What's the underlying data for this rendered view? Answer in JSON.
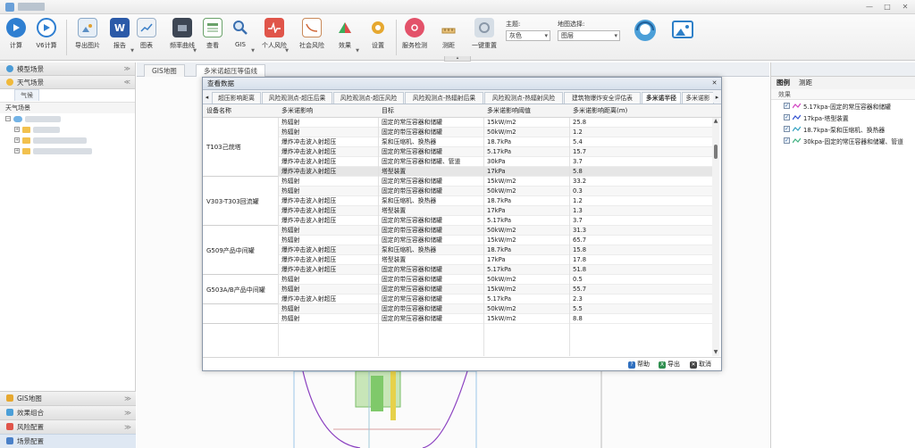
{
  "toolbar": {
    "items": [
      {
        "label": "计算",
        "icon": "play-icon"
      },
      {
        "label": "V6计算",
        "icon": "play-circle-icon"
      },
      {
        "label": "导出图片",
        "icon": "image-icon"
      },
      {
        "label": "报告",
        "icon": "word-icon"
      },
      {
        "label": "图表",
        "icon": "chart-icon"
      },
      {
        "label": "频率曲线",
        "icon": "film-icon"
      },
      {
        "label": "查看",
        "icon": "table-icon"
      },
      {
        "label": "GIS",
        "icon": "search-icon"
      },
      {
        "label": "个人风险",
        "icon": "pulse-icon"
      },
      {
        "label": "社会风险",
        "icon": "curve-icon"
      },
      {
        "label": "效果",
        "icon": "pyramid-icon"
      },
      {
        "label": "设置",
        "icon": "gear-icon"
      },
      {
        "label": "服务检测",
        "icon": "service-icon"
      },
      {
        "label": "测距",
        "icon": "ruler-icon"
      },
      {
        "label": "一键重置",
        "icon": "reset-icon"
      }
    ],
    "theme": {
      "caption": "主题:",
      "value": "灰色"
    },
    "map_select": {
      "caption": "地图选择:",
      "value": "图层"
    }
  },
  "left": {
    "model_scene": "模型场景",
    "weather_scene": "天气场景",
    "subtab": "气候",
    "tree_title": "天气场景",
    "gis_map": "GIS地图",
    "effect_group": "效果组合",
    "risk_config": "风险配置",
    "scene_config": "场景配置"
  },
  "center": {
    "tabs": [
      "GIS地图",
      "多米诺超压等值线"
    ]
  },
  "right": {
    "tabs": [
      "图例",
      "测距"
    ],
    "sub": "效果",
    "legend": [
      {
        "label": "5.17kpa-固定的常压容器和储罐",
        "color": "#d040c0"
      },
      {
        "label": "17kpa-塔型装置",
        "color": "#3050d0"
      },
      {
        "label": "18.7kpa-泵和压缩机、换热器",
        "color": "#30a0c0"
      },
      {
        "label": "30kpa-固定的常压容器和储罐、管道",
        "color": "#40b080"
      }
    ]
  },
  "modal": {
    "title": "查看数据",
    "tabs": [
      "超压影响距离",
      "风险观测点-超压后果",
      "风险观测点-超压风险",
      "风险观测点-热辐射后果",
      "风险观测点-热辐射风险",
      "建筑物爆炸安全评估表",
      "多米诺半径",
      "多米诺影"
    ],
    "columns": [
      "设备名称",
      "多米诺影响",
      "目标",
      "多米诺影响阈值",
      "多米诺影响距离(m)"
    ],
    "groups": [
      {
        "device": "T103己烷塔",
        "rows": [
          [
            "热辐射",
            "固定的常压容器和储罐",
            "15kW/m2",
            "25.8"
          ],
          [
            "热辐射",
            "固定的带压容器和储罐",
            "50kW/m2",
            "1.2"
          ],
          [
            "爆炸冲击波入射超压",
            "泵和压缩机、换热器",
            "18.7kPa",
            "5.4"
          ],
          [
            "爆炸冲击波入射超压",
            "固定的常压容器和储罐",
            "5.17kPa",
            "15.7"
          ],
          [
            "爆炸冲击波入射超压",
            "固定的常压容器和储罐、管道",
            "30kPa",
            "3.7"
          ],
          [
            "爆炸冲击波入射超压",
            "塔型装置",
            "17kPa",
            "5.8"
          ]
        ]
      },
      {
        "device": "V303-T303回流罐",
        "rows": [
          [
            "热辐射",
            "固定的常压容器和储罐",
            "15kW/m2",
            "33.2"
          ],
          [
            "热辐射",
            "固定的带压容器和储罐",
            "50kW/m2",
            "0.3"
          ],
          [
            "爆炸冲击波入射超压",
            "泵和压缩机、换热器",
            "18.7kPa",
            "1.2"
          ],
          [
            "爆炸冲击波入射超压",
            "塔型装置",
            "17kPa",
            "1.3"
          ],
          [
            "爆炸冲击波入射超压",
            "固定的常压容器和储罐",
            "5.17kPa",
            "3.7"
          ]
        ]
      },
      {
        "device": "G509产品中间罐",
        "rows": [
          [
            "热辐射",
            "固定的带压容器和储罐",
            "50kW/m2",
            "31.3"
          ],
          [
            "热辐射",
            "固定的常压容器和储罐",
            "15kW/m2",
            "65.7"
          ],
          [
            "爆炸冲击波入射超压",
            "泵和压缩机、换热器",
            "18.7kPa",
            "15.8"
          ],
          [
            "爆炸冲击波入射超压",
            "塔型装置",
            "17kPa",
            "17.8"
          ],
          [
            "爆炸冲击波入射超压",
            "固定的常压容器和储罐",
            "5.17kPa",
            "51.8"
          ]
        ]
      },
      {
        "device": "G503A/B产品中间罐",
        "rows": [
          [
            "热辐射",
            "固定的带压容器和储罐",
            "50kW/m2",
            "0.5"
          ],
          [
            "热辐射",
            "固定的常压容器和储罐",
            "15kW/m2",
            "55.7"
          ],
          [
            "爆炸冲击波入射超压",
            "固定的常压容器和储罐",
            "5.17kPa",
            "2.3"
          ]
        ]
      },
      {
        "device": "",
        "rows": [
          [
            "热辐射",
            "固定的带压容器和储罐",
            "50kW/m2",
            "5.5"
          ],
          [
            "热辐射",
            "固定的常压容器和储罐",
            "15kW/m2",
            "8.8"
          ]
        ]
      }
    ],
    "footer": {
      "help": "帮助",
      "export": "导出",
      "cancel": "取消"
    }
  }
}
